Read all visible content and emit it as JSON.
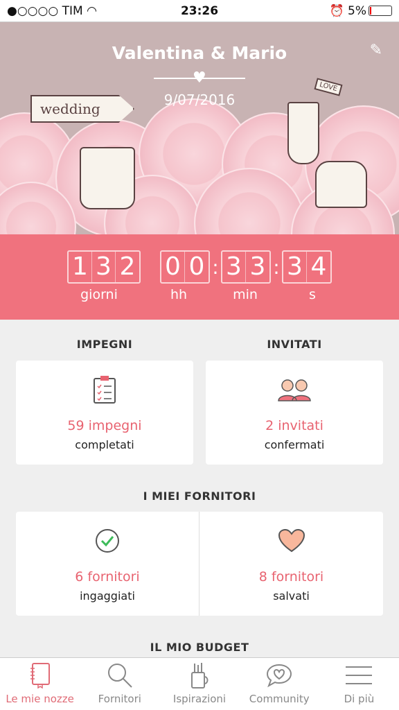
{
  "status_bar": {
    "signal": "●○○○○",
    "carrier": "TIM",
    "time": "23:26",
    "battery": "5%"
  },
  "hero": {
    "names": "Valentina & Mario",
    "date": "9/07/2016",
    "sign_text": "wedding",
    "flag_text": "LOVE"
  },
  "countdown": {
    "days": [
      "1",
      "3",
      "2"
    ],
    "hours": [
      "0",
      "0"
    ],
    "minutes": [
      "3",
      "3"
    ],
    "seconds": [
      "3",
      "4"
    ],
    "labels": {
      "days": "giorni",
      "hours": "hh",
      "minutes": "min",
      "seconds": "s"
    }
  },
  "sections": {
    "impegni": {
      "title": "IMPEGNI",
      "count": "59 impegni",
      "sub": "completati"
    },
    "invitati": {
      "title": "INVITATI",
      "count": "2 invitati",
      "sub": "confermati"
    },
    "fornitori": {
      "title": "I MIEI FORNITORI",
      "engaged_count": "6 fornitori",
      "engaged_sub": "ingaggiati",
      "saved_count": "8 fornitori",
      "saved_sub": "salvati"
    },
    "budget": {
      "title": "IL MIO BUDGET"
    }
  },
  "tabbar": {
    "items": [
      {
        "label": "Le mie nozze",
        "icon": "notebook-icon",
        "active": true
      },
      {
        "label": "Fornitori",
        "icon": "search-icon"
      },
      {
        "label": "Ispirazioni",
        "icon": "pencil-cup-icon"
      },
      {
        "label": "Community",
        "icon": "speech-heart-icon"
      },
      {
        "label": "Di più",
        "icon": "menu-icon"
      }
    ]
  },
  "colors": {
    "accent": "#f0727e",
    "hero_bg": "#c8b3b3",
    "text_accent": "#e86370"
  }
}
